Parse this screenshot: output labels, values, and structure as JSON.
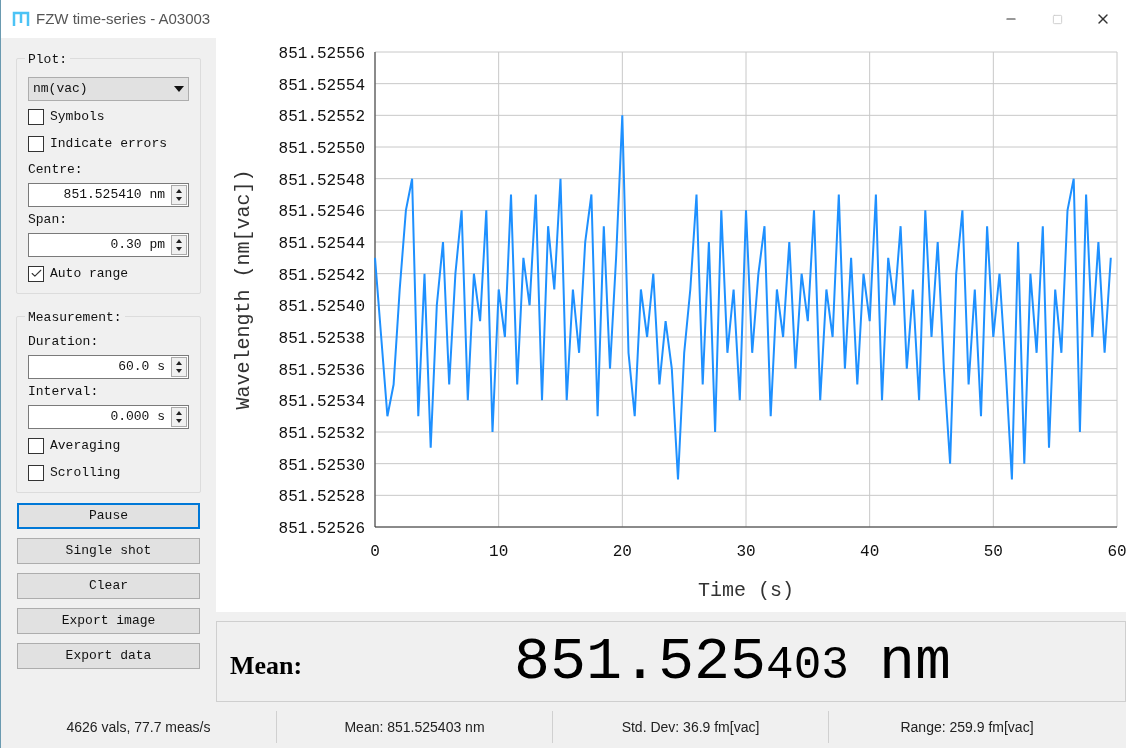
{
  "window": {
    "title": "FZW time-series - A03003"
  },
  "plot_group": {
    "title": "Plot:",
    "unit_select": "nm(vac)",
    "checkboxes": [
      {
        "label": "Symbols",
        "checked": false
      },
      {
        "label": "Indicate errors",
        "checked": false
      }
    ],
    "fields": [
      {
        "label": "Centre:",
        "value": "851.525410 nm"
      },
      {
        "label": "Span:",
        "value": "0.30 pm"
      }
    ],
    "auto_range": {
      "label": "Auto range",
      "checked": true
    }
  },
  "measurement_group": {
    "title": "Measurement:",
    "fields": [
      {
        "label": "Duration:",
        "value": "60.0 s"
      },
      {
        "label": "Interval:",
        "value": "0.000 s"
      }
    ],
    "checkboxes": [
      {
        "label": "Averaging",
        "checked": false
      },
      {
        "label": "Scrolling",
        "checked": false
      }
    ]
  },
  "buttons": [
    {
      "label": "Pause",
      "focused": true
    },
    {
      "label": "Single shot",
      "focused": false
    },
    {
      "label": "Clear",
      "focused": false
    },
    {
      "label": "Export image",
      "focused": false
    },
    {
      "label": "Export data",
      "focused": false
    }
  ],
  "chart": {
    "chart_data": {
      "type": "line",
      "xlabel": "Time (s)",
      "ylabel": "Wavelength (nm[vac])",
      "xlim": [
        0,
        60
      ],
      "ylim": [
        851.52526,
        851.52556
      ],
      "xticks": [
        0,
        10,
        20,
        30,
        40,
        50,
        60
      ],
      "yticks": [
        {
          "value": 851.52526,
          "label": "851.52526"
        },
        {
          "value": 851.52528,
          "label": "851.52528"
        },
        {
          "value": 851.5253,
          "label": "851.52530"
        },
        {
          "value": 851.52532,
          "label": "851.52532"
        },
        {
          "value": 851.52534,
          "label": "851.52534"
        },
        {
          "value": 851.52536,
          "label": "851.52536"
        },
        {
          "value": 851.52538,
          "label": "851.52538"
        },
        {
          "value": 851.5254,
          "label": "851.52540"
        },
        {
          "value": 851.52542,
          "label": "851.52542"
        },
        {
          "value": 851.52544,
          "label": "851.52544"
        },
        {
          "value": 851.52546,
          "label": "851.52546"
        },
        {
          "value": 851.52548,
          "label": "851.52548"
        },
        {
          "value": 851.5255,
          "label": "851.52550"
        },
        {
          "value": 851.52552,
          "label": "851.52552"
        },
        {
          "value": 851.52554,
          "label": "851.52554"
        },
        {
          "value": 851.52556,
          "label": "851.52556"
        }
      ],
      "x": [
        0,
        0.5,
        1,
        1.5,
        2,
        2.5,
        3,
        3.5,
        4,
        4.5,
        5,
        5.5,
        6,
        6.5,
        7,
        7.5,
        8,
        8.5,
        9,
        9.5,
        10,
        10.5,
        11,
        11.5,
        12,
        12.5,
        13,
        13.5,
        14,
        14.5,
        15,
        15.5,
        16,
        16.5,
        17,
        17.5,
        18,
        18.5,
        19,
        19.5,
        20,
        20.5,
        21,
        21.5,
        22,
        22.5,
        23,
        23.5,
        24,
        24.5,
        25,
        25.5,
        26,
        26.5,
        27,
        27.5,
        28,
        28.5,
        29,
        29.5,
        30,
        30.5,
        31,
        31.5,
        32,
        32.5,
        33,
        33.5,
        34,
        34.5,
        35,
        35.5,
        36,
        36.5,
        37,
        37.5,
        38,
        38.5,
        39,
        39.5,
        40,
        40.5,
        41,
        41.5,
        42,
        42.5,
        43,
        43.5,
        44,
        44.5,
        45,
        45.5,
        46,
        46.5,
        47,
        47.5,
        48,
        48.5,
        49,
        49.5,
        50,
        50.5,
        51,
        51.5,
        52,
        52.5,
        53,
        53.5,
        54,
        54.5,
        55,
        55.5,
        56,
        56.5,
        57,
        57.5,
        58,
        58.5,
        59,
        59.5
      ],
      "grid": true,
      "series": [
        {
          "color": "#1e90ff",
          "values": [
            851.52543,
            851.52538,
            851.52533,
            851.52535,
            851.52541,
            851.52546,
            851.52548,
            851.52533,
            851.52542,
            851.52531,
            851.5254,
            851.52544,
            851.52535,
            851.52542,
            851.52546,
            851.52534,
            851.52542,
            851.52539,
            851.52546,
            851.52532,
            851.52541,
            851.52538,
            851.52547,
            851.52535,
            851.52543,
            851.5254,
            851.52547,
            851.52534,
            851.52545,
            851.52541,
            851.52548,
            851.52534,
            851.52541,
            851.52537,
            851.52544,
            851.52547,
            851.52533,
            851.52545,
            851.52536,
            851.52543,
            851.52552,
            851.52537,
            851.52533,
            851.52541,
            851.52538,
            851.52542,
            851.52535,
            851.52539,
            851.52536,
            851.52529,
            851.52537,
            851.52541,
            851.52547,
            851.52535,
            851.52544,
            851.52532,
            851.52546,
            851.52537,
            851.52541,
            851.52534,
            851.52546,
            851.52537,
            851.52542,
            851.52545,
            851.52533,
            851.52541,
            851.52538,
            851.52544,
            851.52536,
            851.52542,
            851.52539,
            851.52546,
            851.52534,
            851.52541,
            851.52538,
            851.52547,
            851.52536,
            851.52543,
            851.52535,
            851.52542,
            851.52539,
            851.52547,
            851.52534,
            851.52543,
            851.5254,
            851.52545,
            851.52536,
            851.52541,
            851.52534,
            851.52546,
            851.52538,
            851.52544,
            851.52536,
            851.5253,
            851.52542,
            851.52546,
            851.52535,
            851.52541,
            851.52533,
            851.52545,
            851.52538,
            851.52542,
            851.52536,
            851.52529,
            851.52544,
            851.5253,
            851.52542,
            851.52537,
            851.52545,
            851.52531,
            851.52541,
            851.52537,
            851.52546,
            851.52548,
            851.52532,
            851.52547,
            851.52538,
            851.52544,
            851.52537,
            851.52543
          ]
        }
      ]
    }
  },
  "mean_display": {
    "label": "Mean:",
    "value_main": "851.525",
    "value_minor": "403",
    "unit": "nm"
  },
  "status_bar": [
    "4626 vals, 77.7 meas/s",
    "Mean: 851.525403 nm",
    "Std. Dev: 36.9 fm[vac]",
    "Range: 259.9 fm[vac]"
  ]
}
